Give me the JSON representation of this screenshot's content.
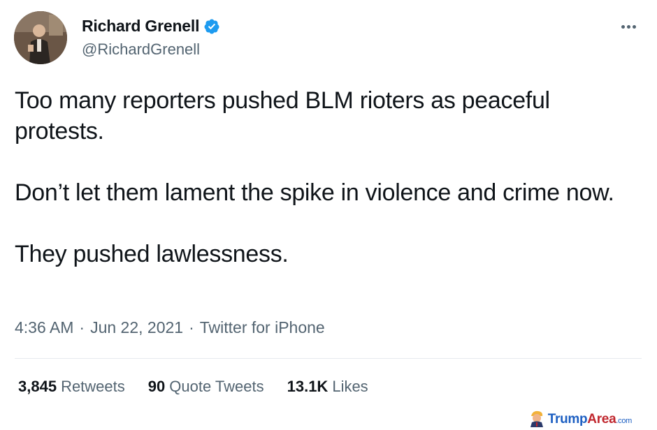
{
  "author": {
    "display_name": "Richard Grenell",
    "handle": "@RichardGrenell",
    "verified": true
  },
  "tweet": {
    "paragraphs": [
      "Too many reporters pushed BLM rioters as peaceful protests.",
      "Don’t let them lament the spike in violence and crime now.",
      "They pushed lawlessness."
    ],
    "time": "4:36 AM",
    "date": "Jun 22, 2021",
    "source": "Twitter for iPhone",
    "separator": "·"
  },
  "stats": {
    "retweets_count": "3,845",
    "retweets_label": "Retweets",
    "quote_count": "90",
    "quote_label": "Quote Tweets",
    "likes_count": "13.1K",
    "likes_label": "Likes"
  },
  "watermark": {
    "brand": "Trump",
    "brand_accent": "Area",
    "suffix": ".com"
  },
  "colors": {
    "text_primary": "#0f1419",
    "text_secondary": "#536471",
    "verified_blue": "#1d9bf0",
    "divider": "#e7eaee"
  },
  "icons": {
    "verified": "verified-badge-icon",
    "more": "more-horizontal-icon"
  }
}
